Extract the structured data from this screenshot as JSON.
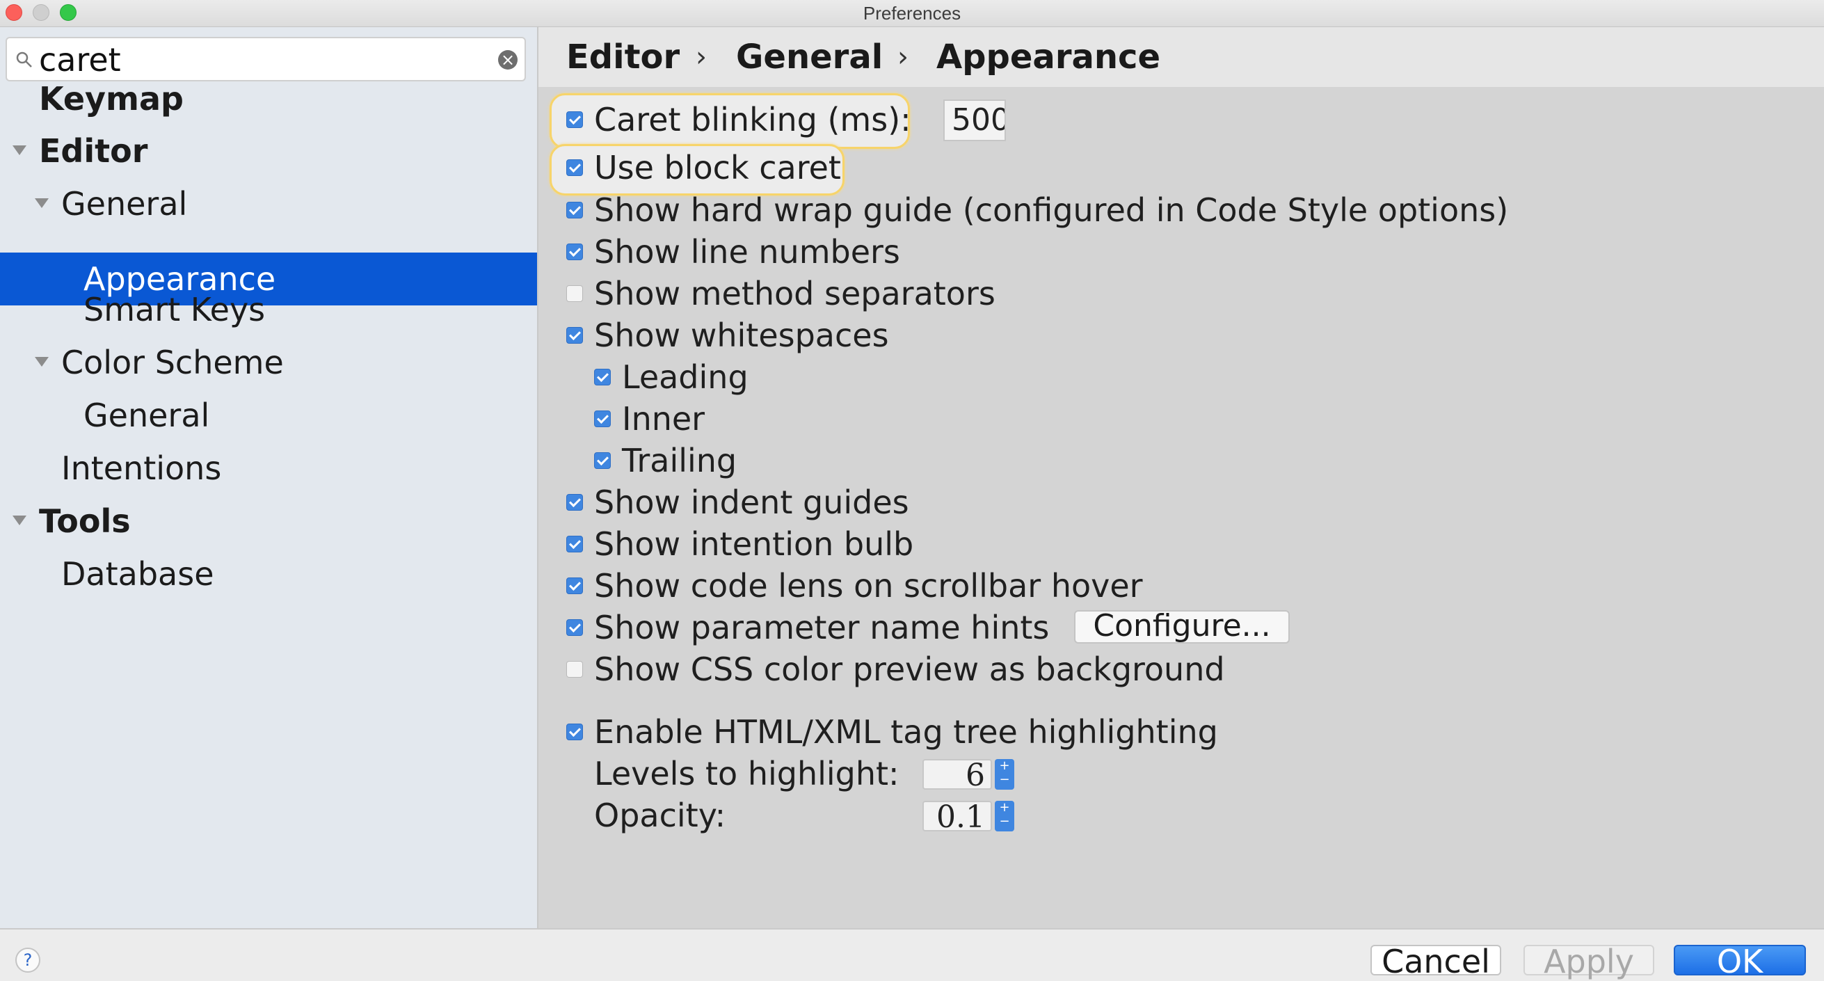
{
  "window": {
    "title": "Preferences"
  },
  "search": {
    "value": "caret"
  },
  "tree": {
    "items": [
      {
        "label": "Keymap"
      },
      {
        "label": "Editor"
      },
      {
        "label": "General"
      },
      {
        "label": "Appearance",
        "selected": true
      },
      {
        "label": "Smart Keys"
      },
      {
        "label": "Color Scheme"
      },
      {
        "label": "General"
      },
      {
        "label": "Intentions"
      },
      {
        "label": "Tools"
      },
      {
        "label": "Database"
      }
    ]
  },
  "breadcrumb": {
    "items": [
      "Editor",
      "General",
      "Appearance"
    ],
    "separator": "›"
  },
  "options": {
    "caret_blinking": {
      "label": "Caret blinking (ms):",
      "value": "500",
      "checked": true
    },
    "block_caret": {
      "label": "Use block caret",
      "checked": true
    },
    "hard_wrap": {
      "label": "Show hard wrap guide (configured in Code Style options)",
      "checked": true
    },
    "line_numbers": {
      "label": "Show line numbers",
      "checked": true
    },
    "method_separators": {
      "label": "Show method separators",
      "checked": false
    },
    "whitespaces": {
      "label": "Show whitespaces",
      "checked": true
    },
    "leading": {
      "label": "Leading",
      "checked": true
    },
    "inner": {
      "label": "Inner",
      "checked": true
    },
    "trailing": {
      "label": "Trailing",
      "checked": true
    },
    "indent_guides": {
      "label": "Show indent guides",
      "checked": true
    },
    "intention_bulb": {
      "label": "Show intention bulb",
      "checked": true
    },
    "code_lens": {
      "label": "Show code lens on scrollbar hover",
      "checked": true
    },
    "param_hints": {
      "label": "Show parameter name hints",
      "checked": true,
      "button": "Configure..."
    },
    "css_preview": {
      "label": "Show CSS color preview as background",
      "checked": false
    },
    "tag_tree": {
      "label": "Enable HTML/XML tag tree highlighting",
      "checked": true
    },
    "levels": {
      "label": "Levels to highlight:",
      "value": "6"
    },
    "opacity": {
      "label": "Opacity:",
      "value": "0.1"
    }
  },
  "footer": {
    "help": "?",
    "cancel": "Cancel",
    "apply": "Apply",
    "ok": "OK"
  },
  "colors": {
    "selection": "#0a58d4",
    "checkbox": "#3f86e0",
    "search_highlight": "#f7d46a"
  }
}
